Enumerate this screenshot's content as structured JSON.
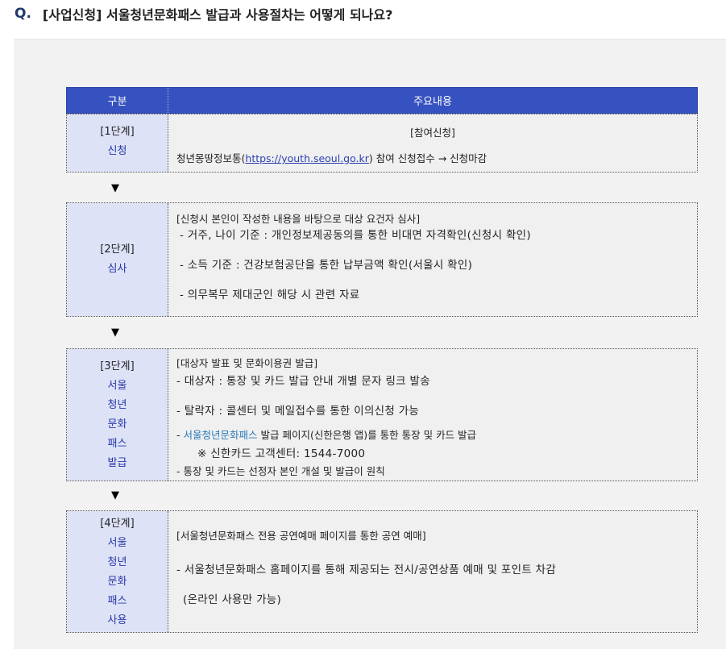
{
  "question": {
    "mark": "Q.",
    "text": "[사업신청] 서울청년문화패스 발급과 사용절차는 어떻게 되나요?"
  },
  "table": {
    "header": {
      "col1": "구분",
      "col2": "주요내용"
    },
    "arrow": "▼",
    "steps": [
      {
        "step": "[1단계]",
        "words": [
          "신청"
        ],
        "title": "[참여신청]",
        "line_prefix": "청년몽땅정보통(",
        "link": "https://youth.seoul.go.kr",
        "line_suffix": ") 참여 신청접수 → 신청마감"
      },
      {
        "step": "[2단계]",
        "words": [
          "심사"
        ],
        "title": "[신청시 본인이 작성한 내용을 바탕으로 대상 요건자 심사]",
        "lines": [
          "- 거주, 나이 기준 : 개인정보제공동의를 통한 비대면 자격확인(신청시 확인)",
          "- 소득 기준 : 건강보험공단을 통한 납부금액 확인(서울시 확인)",
          "- 의무복무 제대군인  해당 시  관련 자료"
        ]
      },
      {
        "step": "[3단계]",
        "words": [
          "서울",
          "청년",
          "문화",
          "패스",
          "발급"
        ],
        "title": "[대상자 발표 및 문화이용권 발급]",
        "lines": [
          "- 대상자 : 통장 및 카드 발급 안내 개별 문자 링크 발송",
          "- 탈락자 : 콜센터 및 메일접수를 통한 이의신청 가능"
        ],
        "issue_prefix": "- ",
        "issue_link": "서울청년문화패스",
        "issue_suffix": " 발급 페이지(신한은행 앱)를 통한 통장 및 카드 발급",
        "note": "※ 신한카드 고객센터: 1544-7000",
        "last": "- 통장 및 카드는 선정자 본인 개설 및 발급이 원칙"
      },
      {
        "step": "[4단계]",
        "words": [
          "서울",
          "청년",
          "문화",
          "패스",
          "사용"
        ],
        "title": "[서울청년문화패스 전용 공연예매 페이지를 통한 공연 예매]",
        "lines": [
          "- 서울청년문화패스 홈페이지를 통해 제공되는 전시/공연상품 예매 및 포인트 차감",
          "(온라인 사용만 가능)"
        ]
      }
    ]
  }
}
